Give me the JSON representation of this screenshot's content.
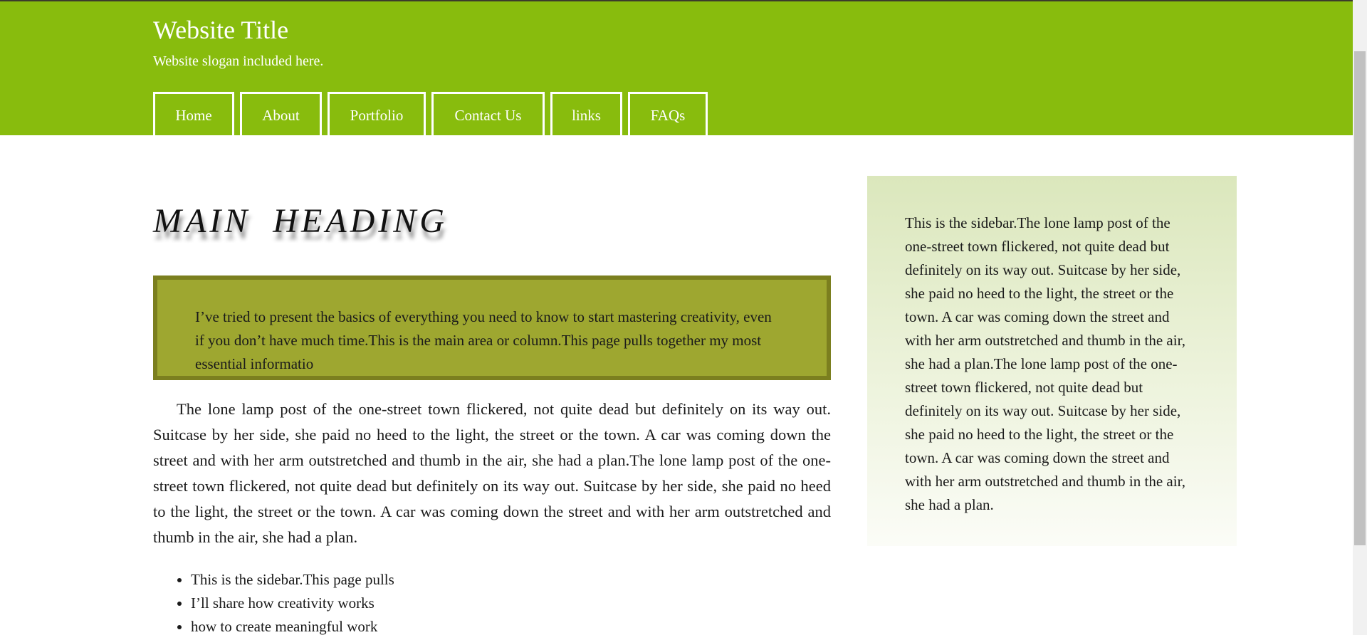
{
  "header": {
    "title": "Website Title",
    "slogan": "Website slogan included here."
  },
  "nav": {
    "items": [
      {
        "label": "Home"
      },
      {
        "label": "About"
      },
      {
        "label": "Portfolio"
      },
      {
        "label": "Contact Us"
      },
      {
        "label": "links"
      },
      {
        "label": "FAQs"
      }
    ]
  },
  "main": {
    "heading": "MAIN HEADING",
    "callout": "I’ve tried to present the basics of everything you need to know to start mastering creativity, even if you don’t have much time.This is the main area or column.This page pulls together my most essential informatio",
    "paragraph": "The lone lamp post of the one-street town flickered, not quite dead but definitely on its way out. Suitcase by her side, she paid no heed to the light, the street or the town. A car was coming down the street and with her arm outstretched and thumb in the air, she had a plan.The lone lamp post of the one-street town flickered, not quite dead but definitely on its way out. Suitcase by her side, she paid no heed to the light, the street or the town. A car was coming down the street and with her arm outstretched and thumb in the air, she had a plan.",
    "bullets": [
      "This is the sidebar.This page pulls",
      "I’ll share how creativity works",
      "how to create meaningful work"
    ]
  },
  "sidebar": {
    "text": "This is the sidebar.The lone lamp post of the one-street town flickered, not quite dead but definitely on its way out. Suitcase by her side, she paid no heed to the light, the street or the town. A car was coming down the street and with her arm outstretched and thumb in the air, she had a plan.The lone lamp post of the one-street town flickered, not quite dead but definitely on its way out. Suitcase by her side, she paid no heed to the light, the street or the town. A car was coming down the street and with her arm outstretched and thumb in the air, she had a plan."
  },
  "colors": {
    "header_bg": "#88bc0d",
    "callout_bg": "#9ea730",
    "callout_border": "#7b7f1f",
    "sidebar_bg": "#dbe7bc"
  }
}
